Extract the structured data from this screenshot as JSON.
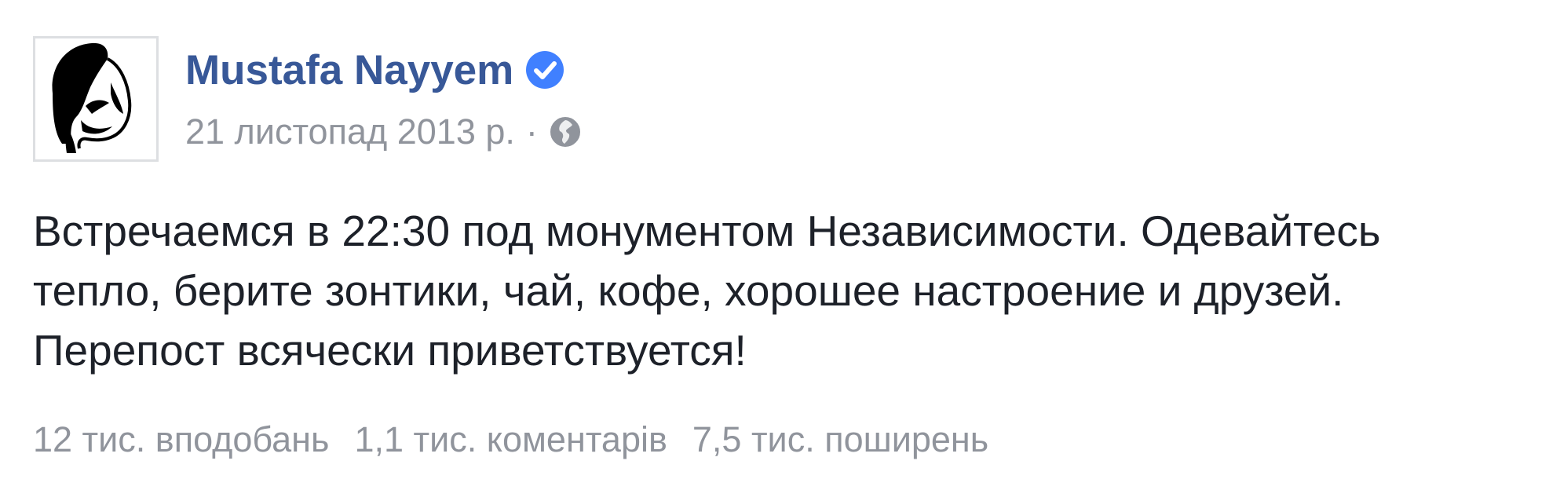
{
  "post": {
    "author": {
      "name": "Mustafa Nayyem",
      "verified": true,
      "avatar_icon": "masked-face-avatar"
    },
    "meta": {
      "date": "21 листопад 2013 р.",
      "separator": "·",
      "audience_icon": "globe-icon"
    },
    "text_lines": [
      "Встречаемся в 22:30 под монументом Независимости. Одевайтесь",
      "тепло, берите зонтики, чай, кофе, хорошее настроение и друзей.",
      "Перепост всячески приветствуется!"
    ],
    "stats": {
      "likes": "12 тис. вподобань",
      "comments": "1,1 тис. коментарів",
      "shares": "7,5 тис. поширень"
    }
  },
  "colors": {
    "author_name": "#385898",
    "verified_badge": "#4080ff",
    "meta_text": "#90949c",
    "body_text": "#1d2129"
  }
}
